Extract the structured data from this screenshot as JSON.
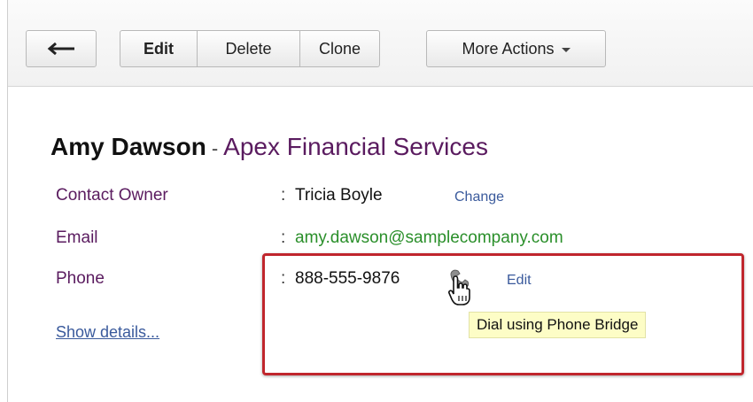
{
  "toolbar": {
    "back_icon": "arrow-left-icon",
    "edit_label": "Edit",
    "delete_label": "Delete",
    "clone_label": "Clone",
    "more_actions_label": "More Actions"
  },
  "contact": {
    "name": "Amy Dawson",
    "separator": "-",
    "company": "Apex Financial Services"
  },
  "fields": {
    "owner_label": "Contact Owner",
    "owner_value": "Tricia Boyle",
    "owner_change_link": "Change",
    "email_label": "Email",
    "email_value": "amy.dawson@samplecompany.com",
    "phone_label": "Phone",
    "phone_value": "888-555-9876",
    "phone_edit_link": "Edit",
    "colon": ":"
  },
  "show_details_link": "Show details...",
  "tooltip_text": "Dial using Phone Bridge",
  "icons": {
    "phone": "phone-handset-icon",
    "cursor": "hand-pointer-icon"
  },
  "colors": {
    "label": "#5a1b5f",
    "email": "#2a8f2a",
    "link": "#3a5a9c",
    "highlight_border": "#c0262d",
    "tooltip_bg": "#fdfdc6"
  }
}
